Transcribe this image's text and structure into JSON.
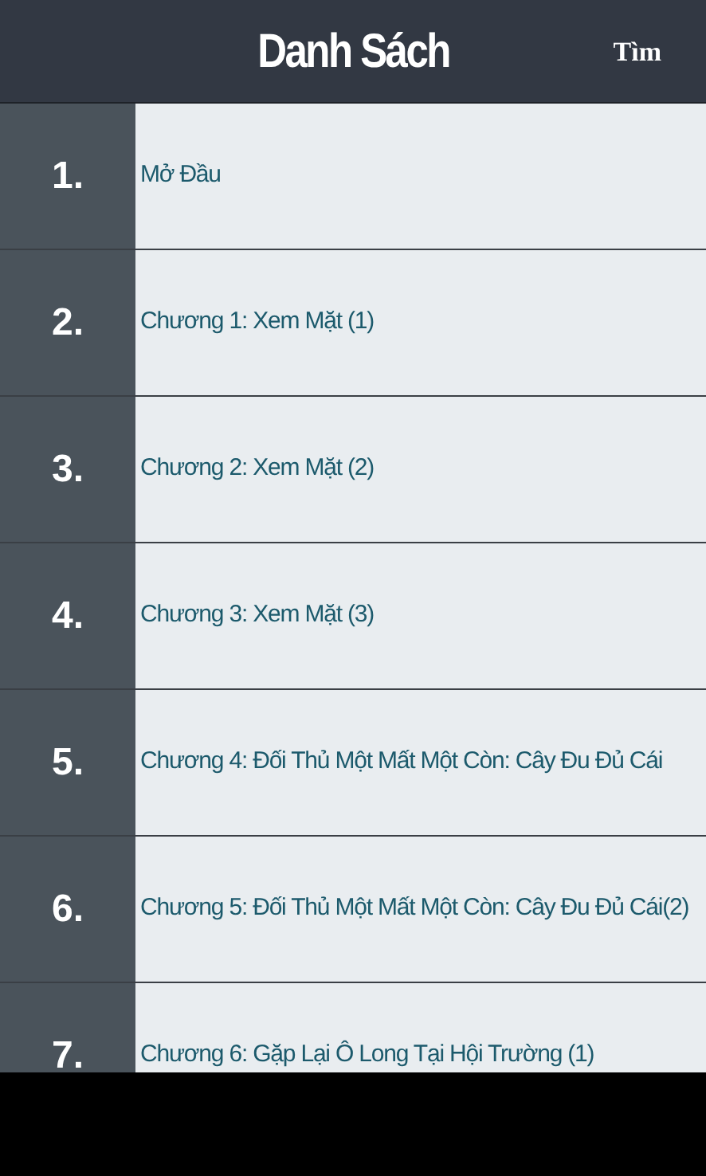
{
  "header": {
    "title": "Danh Sách",
    "search_button": "Tìm"
  },
  "chapters": [
    {
      "number": "1.",
      "title": "Mở Đầu"
    },
    {
      "number": "2.",
      "title": "Chương 1: Xem Mặt (1)"
    },
    {
      "number": "3.",
      "title": "Chương 2: Xem Mặt (2)"
    },
    {
      "number": "4.",
      "title": "Chương 3: Xem Mặt (3)"
    },
    {
      "number": "5.",
      "title": "Chương 4: Đối Thủ Một Mất Một Còn: Cây Đu Đủ Cái"
    },
    {
      "number": "6.",
      "title": "Chương 5: Đối Thủ Một Mất Một Còn: Cây Đu Đủ Cái(2)"
    },
    {
      "number": "7.",
      "title": "Chương 6: Gặp Lại Ô Long Tại Hội Trường (1)"
    }
  ]
}
